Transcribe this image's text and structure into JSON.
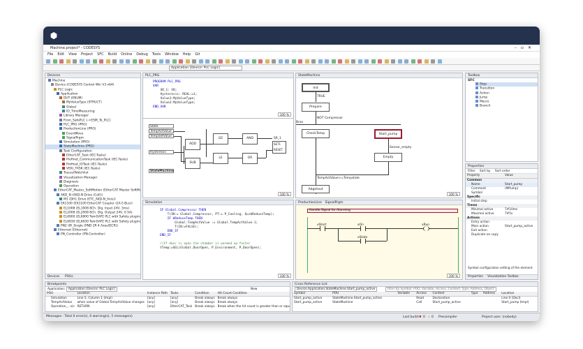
{
  "window": {
    "title": "Machine.project* - CODESYS"
  },
  "menu": [
    "File",
    "Edit",
    "View",
    "Project",
    "SFC",
    "Build",
    "Online",
    "Debug",
    "Tools",
    "Window",
    "Help",
    "Git"
  ],
  "toolbar": {
    "app_combo": "Application [Device: PLC Logic]"
  },
  "devices": {
    "title": "Devices",
    "items": [
      "Machine",
      "Device (CODESYS Control Win V3 x64)",
      "PLC Logic",
      "Application",
      "DUT (ENUM)",
      "MyValueType (STRUCT)",
      "Global",
      "IO_TimeMeasuring",
      "Library Manager",
      "From_SafePLC (->ESM_To_PLC)",
      "PLC_PRG (PRG)",
      "ProductionLine (PRG)",
      "EventMove",
      "SignalPrgm",
      "Simulation (PRG)",
      "StateMachine (PRG)",
      "Task Configuration",
      "EtherCAT_Task (IEC-Tasks)",
      "Profinet_CommunicationTask (IEC-Tasks)",
      "Profinet_IOTask (IEC-Tasks)",
      "VISU_TASK (IEC-Tasks)",
      "Traces/Watchlist",
      "Visualization Manager",
      "Diagnosis",
      "Operation",
      "EtherCAT_Master_SoftMotion (EtherCAT Master SoftMotion)",
      "AKD_N (AKD-N Drive (CoE))",
      "M1 (DH1 Drive (ETC_AKD-N_Axis))",
      "EK1100 (EK1100 EtherCAT Coupler (2A E-Bus))",
      "EL1008 (EL1008 8Ch. Dig. Input 24V, 3ms)",
      "EL2008 (EL2008 8Ch. Dig. Output 24V, 0.5A)",
      "EL6900 (EL6900 TwinSAFE PLC with Safety plugins)",
      "EL6930 (EL6930 TwinSAFE PLC with Safety plugins)",
      "PN2 (IR_Single (PND 2R 4 Axes/DCR))",
      "Ethernet (Ethernet)",
      "PN_Controller (PN-Controller)"
    ],
    "bottom_tabs": [
      "Devices",
      "POUs"
    ]
  },
  "plc_prg": {
    "tab": "PLC_PRG",
    "code": [
      "PROGRAM PLC_PRG",
      "VAR",
      "    SR_1: SR;",
      "    Hysteresis: REAL:=1;",
      "    Value1:MyValueType;",
      "    Value2:MyValueType;",
      "END_VAR"
    ],
    "zoom": "100 %",
    "fbd_vars": [
      "State",
      "TempActValue",
      "TempSetValue",
      "Hysteresis",
      "StateMachine"
    ],
    "fbd_blocks": [
      "ADD",
      "GE",
      "AND",
      "SUB",
      "LE",
      "OR",
      "SR_1"
    ],
    "sr_pins": [
      "SET1",
      "RESET"
    ]
  },
  "state_machine": {
    "tab": "StateMachine",
    "steps": [
      "Init",
      "Prepare",
      "CheckTemp",
      "Start_pump",
      "Empty",
      "Abgetaut"
    ],
    "transitions": [
      "TRUE",
      "NOT Compressor",
      "Sensor_empty",
      "TempActValue>=Tempstate"
    ],
    "label_bran": "Bran",
    "zoom": "100 %"
  },
  "simulation": {
    "tab": "Simulation",
    "code": [
      "IF Global.Compressor THEN",
      "    T(IN:= Global.Compressor, PT:= P_Cooling, Q=>bReduceTemp);",
      "    IF bReduceTemp THEN",
      "        Global.TempActValue := Global.TempActValue-1;",
      "        T(IN:=FALSE);",
      "    END_IF",
      "END_IF",
      "",
      "//If door is open the chamber is warmed up faster",
      "tTemp:=SEL(Global.DoorOpen, P_Environment, P_DoorOpen);"
    ],
    "zoom": "100 %"
  },
  "production_line": {
    "tabs": [
      "ProductionLine",
      "SignalPrgm"
    ],
    "comment": "Handle Signal for Alarming",
    "contacts": [
      "xStart",
      "xOn",
      "xState"
    ],
    "coil": "xRun",
    "zoom": "100 %"
  },
  "toolbox": {
    "title": "Toolbox",
    "group": "SFC",
    "items": [
      "Step",
      "Transition",
      "Action",
      "Jump",
      "Macro",
      "Branch"
    ]
  },
  "properties": {
    "title": "Properties",
    "filter": "Filter",
    "sort_by": "Sort by",
    "sort_order": "Sort order",
    "headers": [
      "Property",
      "Value"
    ],
    "rows": [
      {
        "p": "Common",
        "v": "",
        "group": true
      },
      {
        "p": "Name",
        "v": "Start_pump"
      },
      {
        "p": "Comment",
        "v": "(MPump)"
      },
      {
        "p": "Symbol",
        "v": ""
      },
      {
        "p": "Specific",
        "v": "",
        "group": true
      },
      {
        "p": "Initial step",
        "v": ""
      },
      {
        "p": "Times",
        "v": "",
        "group": true
      },
      {
        "p": "Minimal active",
        "v": "T#10ms"
      },
      {
        "p": "Maximal active",
        "v": "T#5s"
      },
      {
        "p": "Actions",
        "v": "",
        "group": true
      },
      {
        "p": "Entry action",
        "v": ""
      },
      {
        "p": "Main action",
        "v": "Start_pump_active"
      },
      {
        "p": "Exit action",
        "v": ""
      },
      {
        "p": "Duplicate on copy",
        "v": ""
      }
    ],
    "footer": "Symbol configuration setting of the element",
    "bottom_tabs": [
      "Properties",
      "Visualization Toolbox"
    ]
  },
  "breakpoints": {
    "title": "Breakpoints",
    "app_label": "Application:",
    "app_value": "Application [Device: PLC Logic]",
    "new_label": "New",
    "headers": [
      "POU",
      "Location",
      "Instance Path",
      "Tasks",
      "Condition",
      "Hit Count Condition",
      "Hit Count"
    ],
    "rows": [
      [
        "Simulation",
        "Line 5, Column 1 (Impl)",
        "[any]",
        "[any]",
        "Break always",
        "Break always",
        ""
      ],
      [
        "TempActValue",
        "when value of Global.TempActValue changes",
        "[any]",
        "[any]",
        "Break always",
        "Break always",
        ""
      ],
      [
        "Operation_...vis",
        "RETURN",
        "[any]",
        "EtherCAT_Task",
        "Break always",
        "Break when the hit count is greater than or equal to 3",
        ""
      ]
    ],
    "footer": "Messages - Total 0 error(s), 0 warning(s), 5 message(s)"
  },
  "xref": {
    "title": "Cross Reference List",
    "path": "Device.Application.StateMachine.Start_pump_active",
    "filter_hint": "Filter by Symbol, POU, Variable, Access, Context, Type, Address, Object",
    "headers": [
      "Symbol",
      "POU",
      "Variable",
      "Access",
      "Context",
      "Type",
      "Address",
      "Location"
    ],
    "rows": [
      [
        "Start_pump_active",
        "StateMachine.Start_pump_active",
        "",
        "Read",
        "Declaration",
        "",
        "",
        "Line 0 (Decl)"
      ],
      [
        "Start_pump_active",
        "StateMachine",
        "",
        "Call",
        "Start_pump_active",
        "",
        "",
        "Start_pump (Impl)"
      ]
    ]
  },
  "status": {
    "last_build": "Last build:",
    "build_errors": "0",
    "build_warnings": "0",
    "precompile": "Precompile",
    "user": "Project user: (nobody)"
  }
}
